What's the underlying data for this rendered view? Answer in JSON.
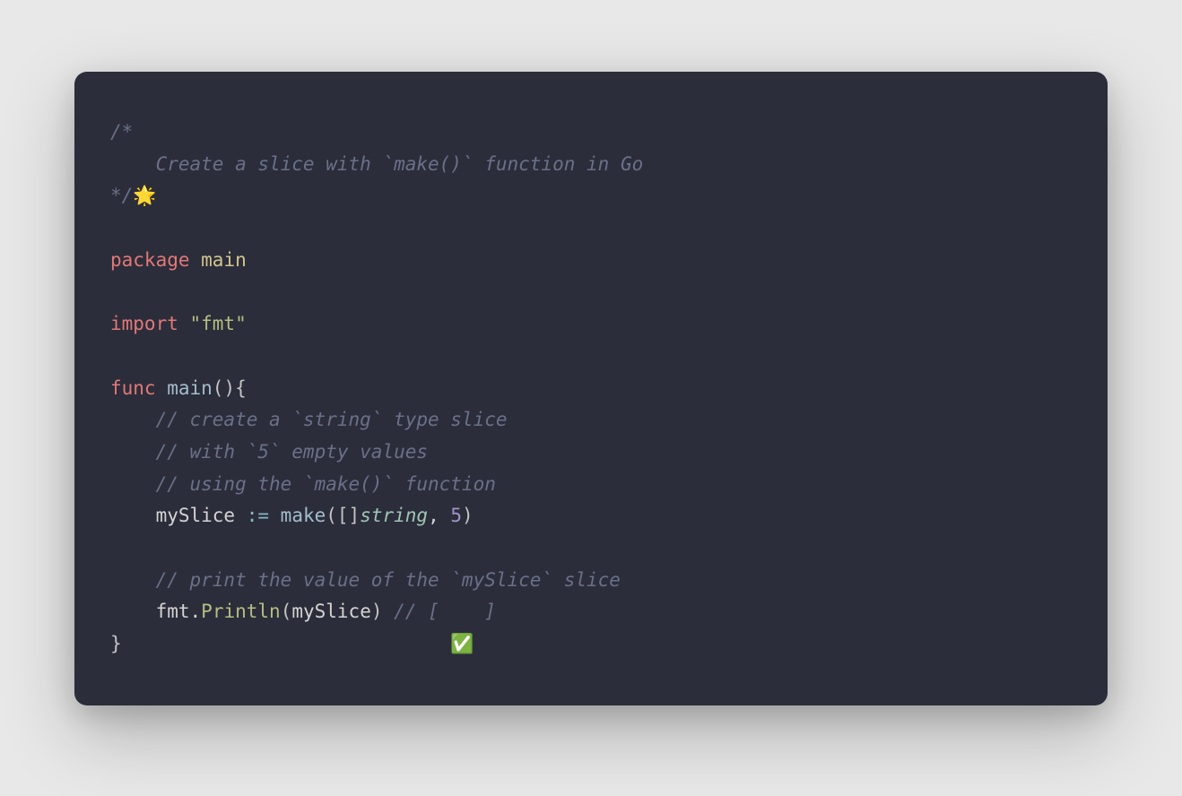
{
  "code": {
    "comment_block_open": "/*",
    "comment_block_line": "    Create a slice with `make()` function in Go",
    "comment_block_close": "*/",
    "emoji_star": "🌟",
    "keyword_package": "package",
    "package_name": " main",
    "keyword_import": "import",
    "import_value": " \"fmt\"",
    "keyword_func": "func",
    "func_name": " main",
    "func_parens": "()",
    "brace_open": "{",
    "comment_1": "    // create a `string` type slice",
    "comment_2": "    // with `5` empty values",
    "comment_3": "    // using the `make()` function",
    "indent": "    ",
    "var_name": "mySlice ",
    "assign_op": ":=",
    "make_call": " make",
    "paren_open": "(",
    "bracket_pair": "[]",
    "type_string": "string",
    "comma_sp": ", ",
    "number_5": "5",
    "paren_close": ")",
    "comment_4": "    // print the value of the `mySlice` slice",
    "fmt_pkg": "fmt",
    "dot": ".",
    "println": "Println",
    "arg_myslice": "mySlice",
    "comment_result": " // [    ]",
    "brace_close": "}",
    "padding_spaces": "                             ",
    "emoji_check": "✅"
  }
}
